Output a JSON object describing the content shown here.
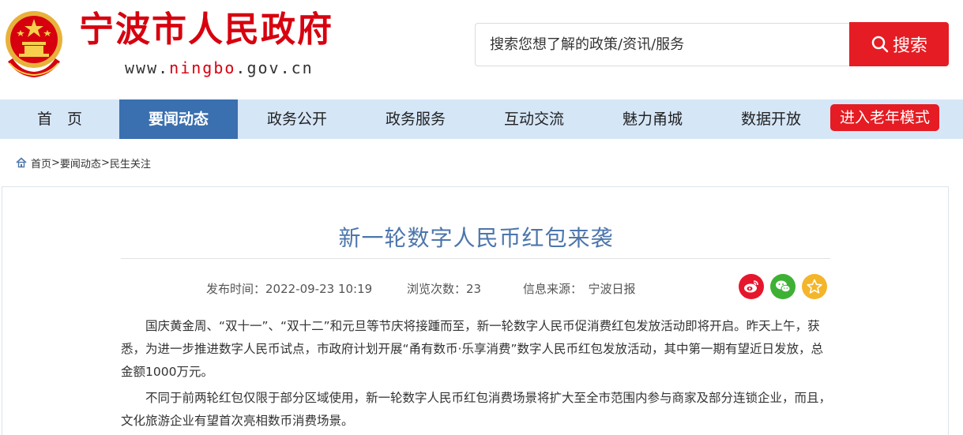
{
  "header": {
    "title": "宁波市人民政府",
    "url_prefix": "www.",
    "url_highlight": "ningbo",
    "url_suffix": ".gov.cn",
    "emblem_icon": "national-emblem-icon"
  },
  "search": {
    "placeholder": "搜索您想了解的政策/资讯/服务",
    "button_label": "搜索"
  },
  "nav": {
    "items": [
      {
        "label": "首　页"
      },
      {
        "label": "要闻动态"
      },
      {
        "label": "政务公开"
      },
      {
        "label": "政务服务"
      },
      {
        "label": "互动交流"
      },
      {
        "label": "魅力甬城"
      },
      {
        "label": "数据开放"
      }
    ],
    "elder_mode": "进入老年模式"
  },
  "breadcrumb": {
    "home": "首页",
    "sep1": ">",
    "level2": "要闻动态",
    "sep2": ">",
    "level3": "民生关注"
  },
  "article": {
    "title": "新一轮数字人民币红包来袭",
    "publish_time": "发布时间：2022-09-23 10:19",
    "views": "浏览次数：23",
    "source": "信息来源：　宁波日报",
    "paragraphs": [
      "国庆黄金周、“双十一”、“双十二”和元旦等节庆将接踵而至，新一轮数字人民币促消费红包发放活动即将开启。昨天上午，获悉，为进一步推进数字人民币试点，市政府计划开展“甬有数币·乐享消费”数字人民币红包发放活动，其中第一期有望近日发放，总金额1000万元。",
      "不同于前两轮红包仅限于部分区域使用，新一轮数字人民币红包消费场景将扩大至全市范围内参与商家及部分连锁企业，而且，文化旅游企业有望首次亮相数币消费场景。"
    ]
  },
  "colors": {
    "brand_red": "#d7000f",
    "nav_bg": "#d5e6f7",
    "nav_active": "#3a6fb0",
    "title_blue": "#4c76ac"
  }
}
